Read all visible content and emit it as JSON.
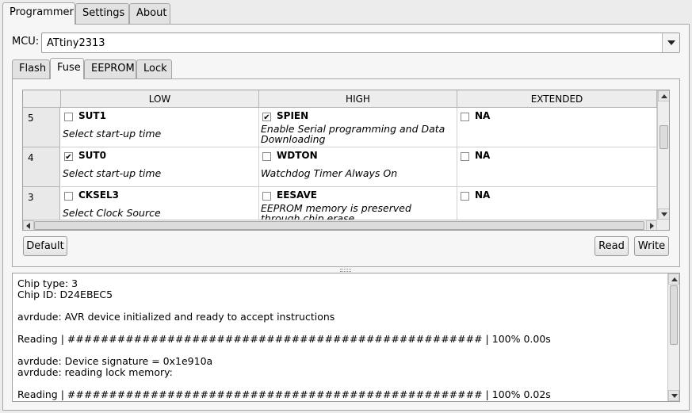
{
  "main_tabs": [
    "Programmer",
    "Settings",
    "About"
  ],
  "mcu": {
    "label": "MCU:",
    "value": "ATtiny2313"
  },
  "sub_tabs": [
    "Flash",
    "Fuse",
    "EEPROM",
    "Lock"
  ],
  "fuse_table": {
    "columns": [
      "LOW",
      "HIGH",
      "EXTENDED"
    ],
    "rows": [
      {
        "index": "5",
        "cells": [
          {
            "name": "SUT1",
            "checked": false,
            "desc": "Select start-up time"
          },
          {
            "name": "SPIEN",
            "checked": true,
            "desc": "Enable Serial programming and Data Downloading"
          },
          {
            "name": "NA",
            "checked": false,
            "desc": ""
          }
        ]
      },
      {
        "index": "4",
        "cells": [
          {
            "name": "SUT0",
            "checked": true,
            "desc": "Select start-up time"
          },
          {
            "name": "WDTON",
            "checked": false,
            "desc": "Watchdog Timer Always On"
          },
          {
            "name": "NA",
            "checked": false,
            "desc": ""
          }
        ]
      },
      {
        "index": "3",
        "cells": [
          {
            "name": "CKSEL3",
            "checked": false,
            "desc": "Select Clock Source"
          },
          {
            "name": "EESAVE",
            "checked": false,
            "desc": "EEPROM memory is preserved through chip erase"
          },
          {
            "name": "NA",
            "checked": false,
            "desc": ""
          }
        ]
      }
    ]
  },
  "buttons": {
    "default": "Default",
    "read": "Read",
    "write": "Write"
  },
  "log": [
    "Chip type: 3",
    "Chip ID: D24EBEC5",
    "",
    "avrdude: AVR device initialized and ready to accept instructions",
    "",
    "Reading | ################################################## | 100% 0.00s",
    "",
    "avrdude: Device signature = 0x1e910a",
    "avrdude: reading lock memory:",
    "",
    "Reading | ################################################## | 100% 0.02s"
  ]
}
